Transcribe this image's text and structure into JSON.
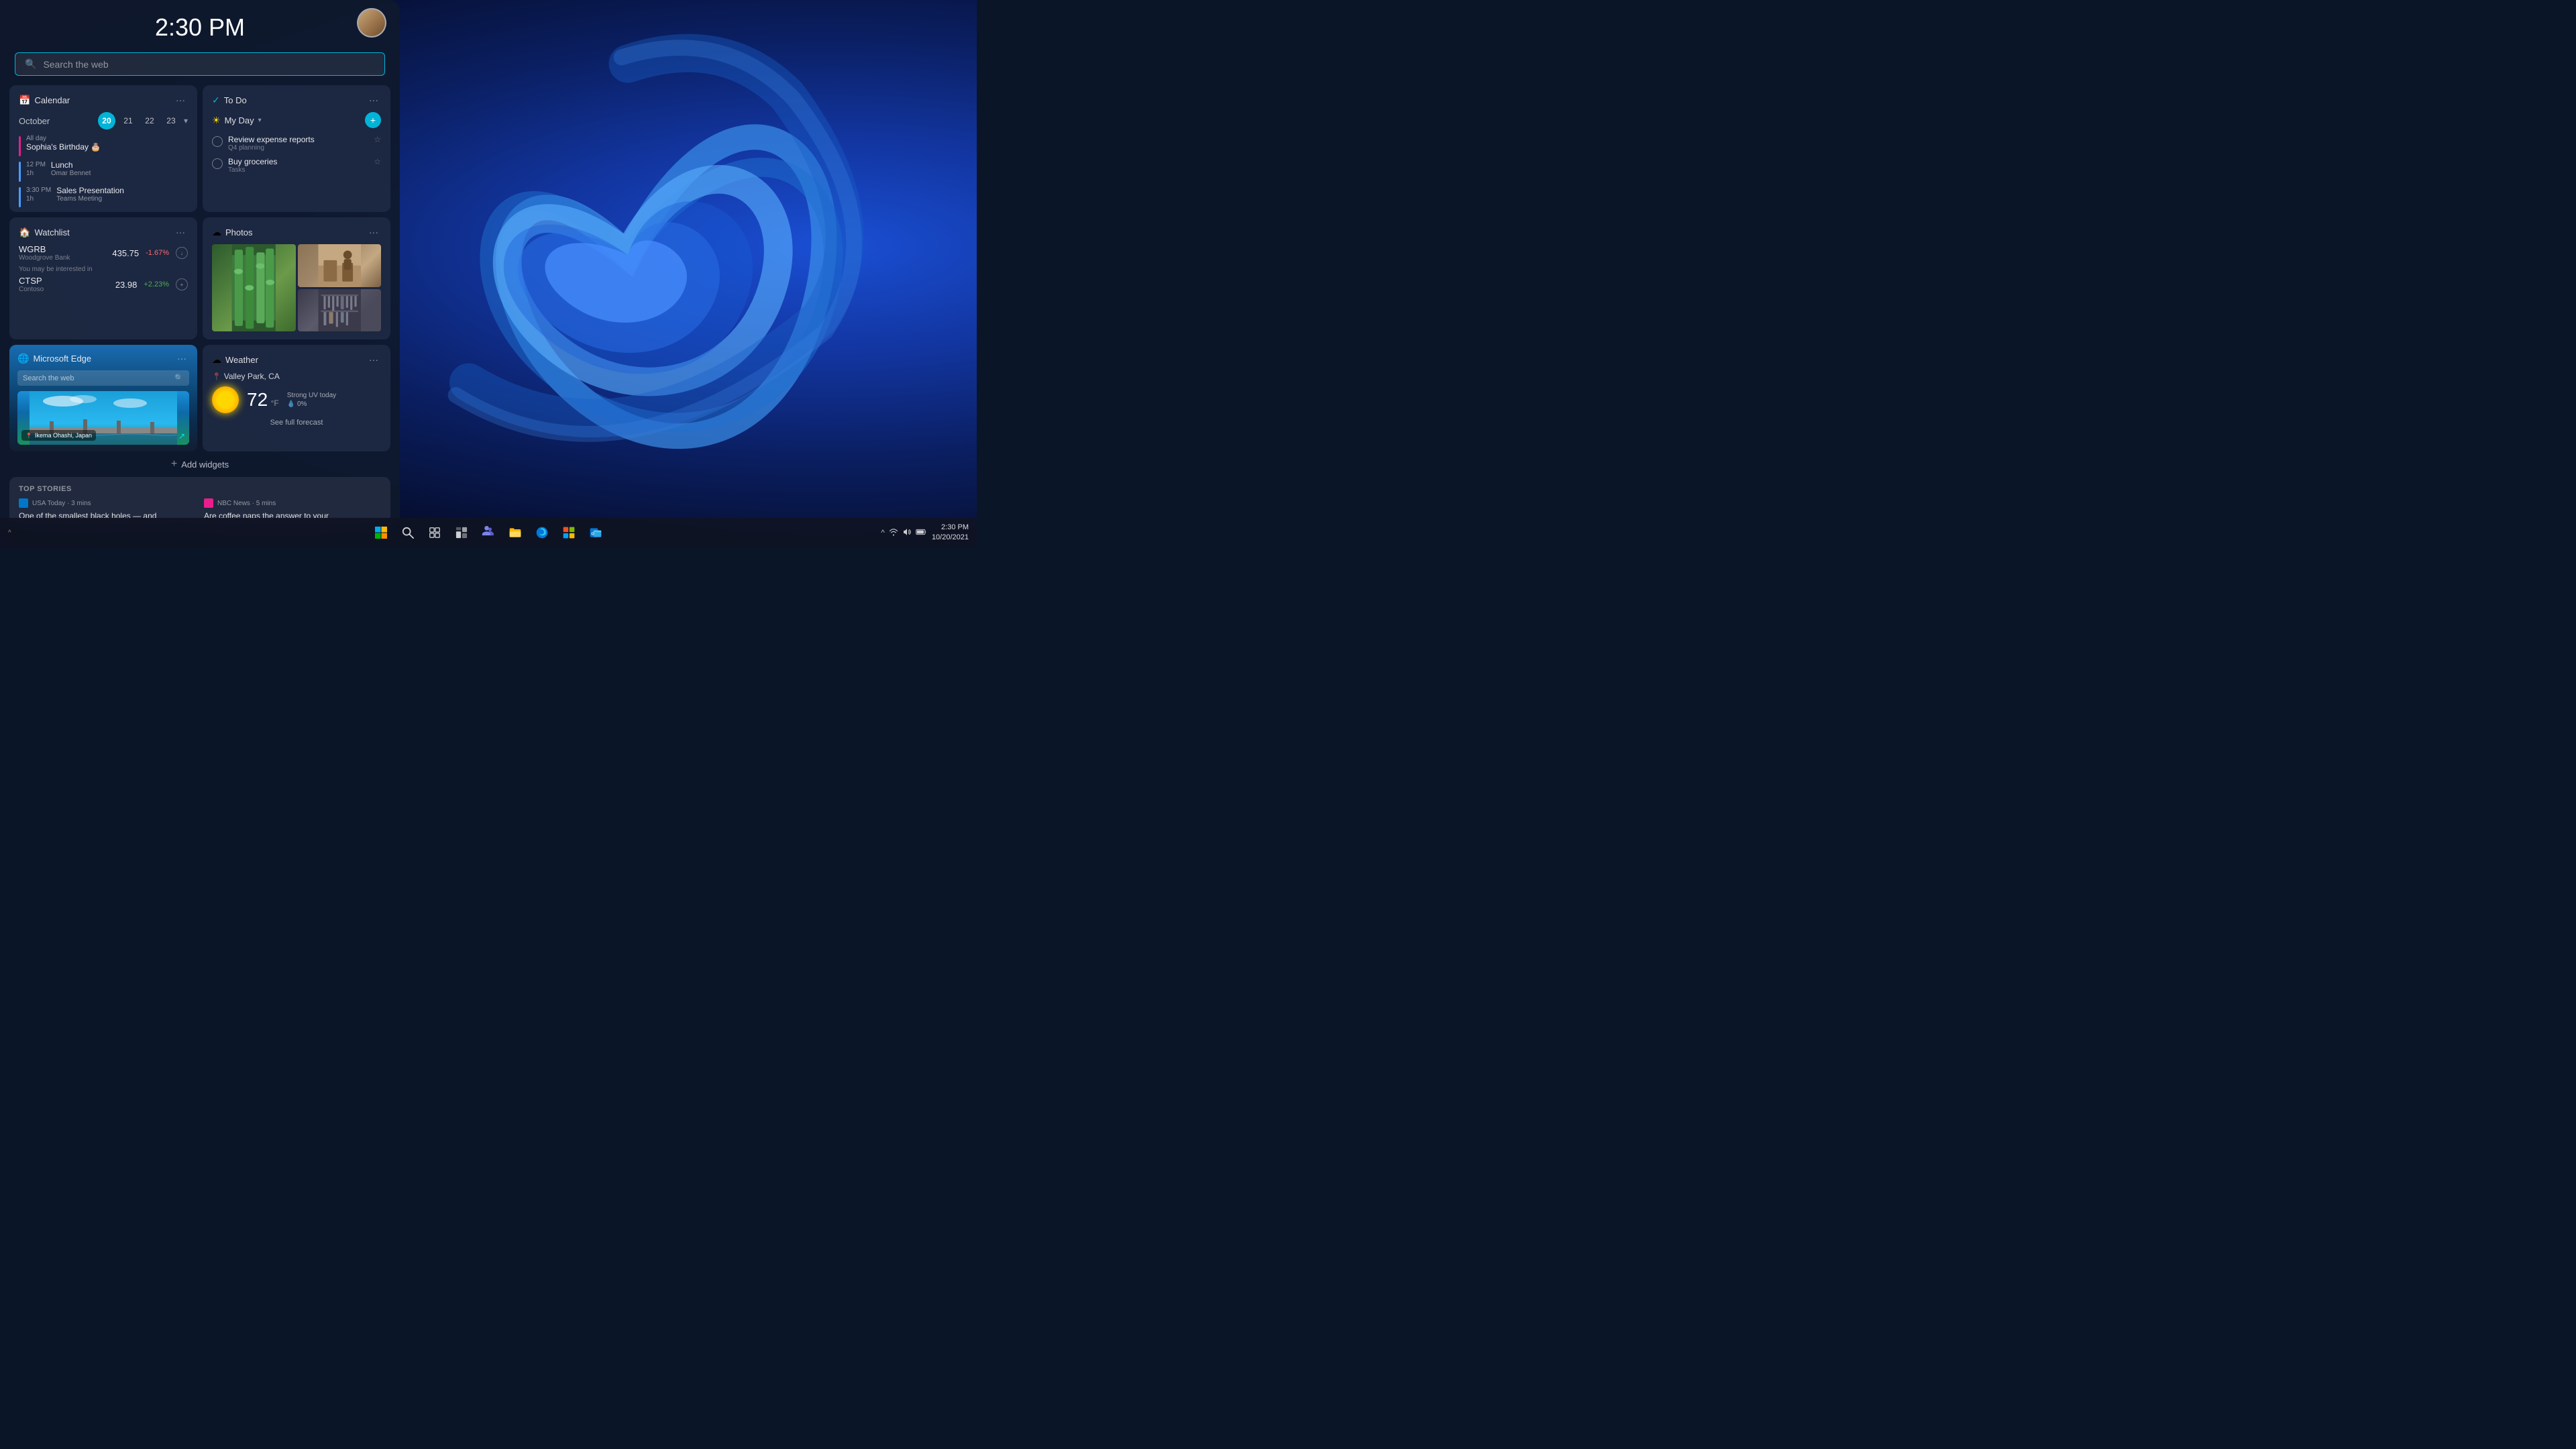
{
  "desktop": {
    "time": "2:30 PM",
    "taskbar_time": "2:30 PM",
    "taskbar_date": "10/20/2021"
  },
  "search": {
    "placeholder": "Search the web"
  },
  "calendar": {
    "title": "Calendar",
    "month": "October",
    "days": [
      {
        "num": "20",
        "today": true
      },
      {
        "num": "21",
        "today": false
      },
      {
        "num": "22",
        "today": false
      },
      {
        "num": "23",
        "today": false
      }
    ],
    "events": [
      {
        "time": "All day",
        "duration": "",
        "title": "Sophia's Birthday 🎂",
        "sub": "",
        "allday": true,
        "color": "pink"
      },
      {
        "time": "12 PM",
        "duration": "1h",
        "title": "Lunch",
        "sub": "Omar Bennet",
        "allday": false,
        "color": "blue"
      },
      {
        "time": "3:30 PM",
        "duration": "1h",
        "title": "Sales Presentation",
        "sub": "Teams Meeting",
        "allday": false,
        "color": "blue"
      }
    ]
  },
  "todo": {
    "title": "To Do",
    "myday_label": "My Day",
    "tasks": [
      {
        "title": "Review expense reports",
        "sub": "Q4 planning",
        "starred": false
      },
      {
        "title": "Buy groceries",
        "sub": "Tasks",
        "starred": false
      }
    ]
  },
  "watchlist": {
    "title": "Watchlist",
    "stocks": [
      {
        "ticker": "WGRB",
        "name": "Woodgrove Bank",
        "price": "435.75",
        "change": "-1.67%",
        "direction": "negative"
      }
    ],
    "may_interest": "You may be interested in",
    "suggested": [
      {
        "ticker": "CTSP",
        "name": "Contoso",
        "price": "23.98",
        "change": "+2.23%",
        "direction": "positive"
      }
    ]
  },
  "photos": {
    "title": "Photos"
  },
  "edge": {
    "title": "Microsoft Edge",
    "search_placeholder": "Search the web",
    "location": "Ikema Ohashi, Japan"
  },
  "weather": {
    "title": "Weather",
    "location": "Valley Park, CA",
    "temp": "72",
    "unit": "°F",
    "condition": "Strong UV today",
    "rain": "0%",
    "rain_label": "💧 0%",
    "forecast_link": "See full forecast"
  },
  "add_widgets": {
    "label": "Add widgets"
  },
  "top_stories": {
    "header": "TOP STORIES",
    "stories": [
      {
        "source": "USA Today",
        "time": "3 mins",
        "headline": "One of the smallest black holes — and"
      },
      {
        "source": "NBC News",
        "time": "5 mins",
        "headline": "Are coffee naps the answer to your"
      }
    ]
  },
  "taskbar": {
    "icons": [
      {
        "name": "windows-start",
        "symbol": "⊞"
      },
      {
        "name": "search",
        "symbol": "🔍"
      },
      {
        "name": "task-view",
        "symbol": "❑"
      },
      {
        "name": "widgets",
        "symbol": "▦"
      },
      {
        "name": "teams",
        "symbol": "T"
      },
      {
        "name": "file-explorer",
        "symbol": "📁"
      },
      {
        "name": "edge-browser",
        "symbol": "◑"
      },
      {
        "name": "microsoft-store",
        "symbol": "⊕"
      },
      {
        "name": "outlook",
        "symbol": "✉"
      }
    ],
    "system_icons": [
      "^",
      "📶",
      "🔊",
      "🔋"
    ],
    "time": "2:30 PM",
    "date": "10/20/2021"
  }
}
